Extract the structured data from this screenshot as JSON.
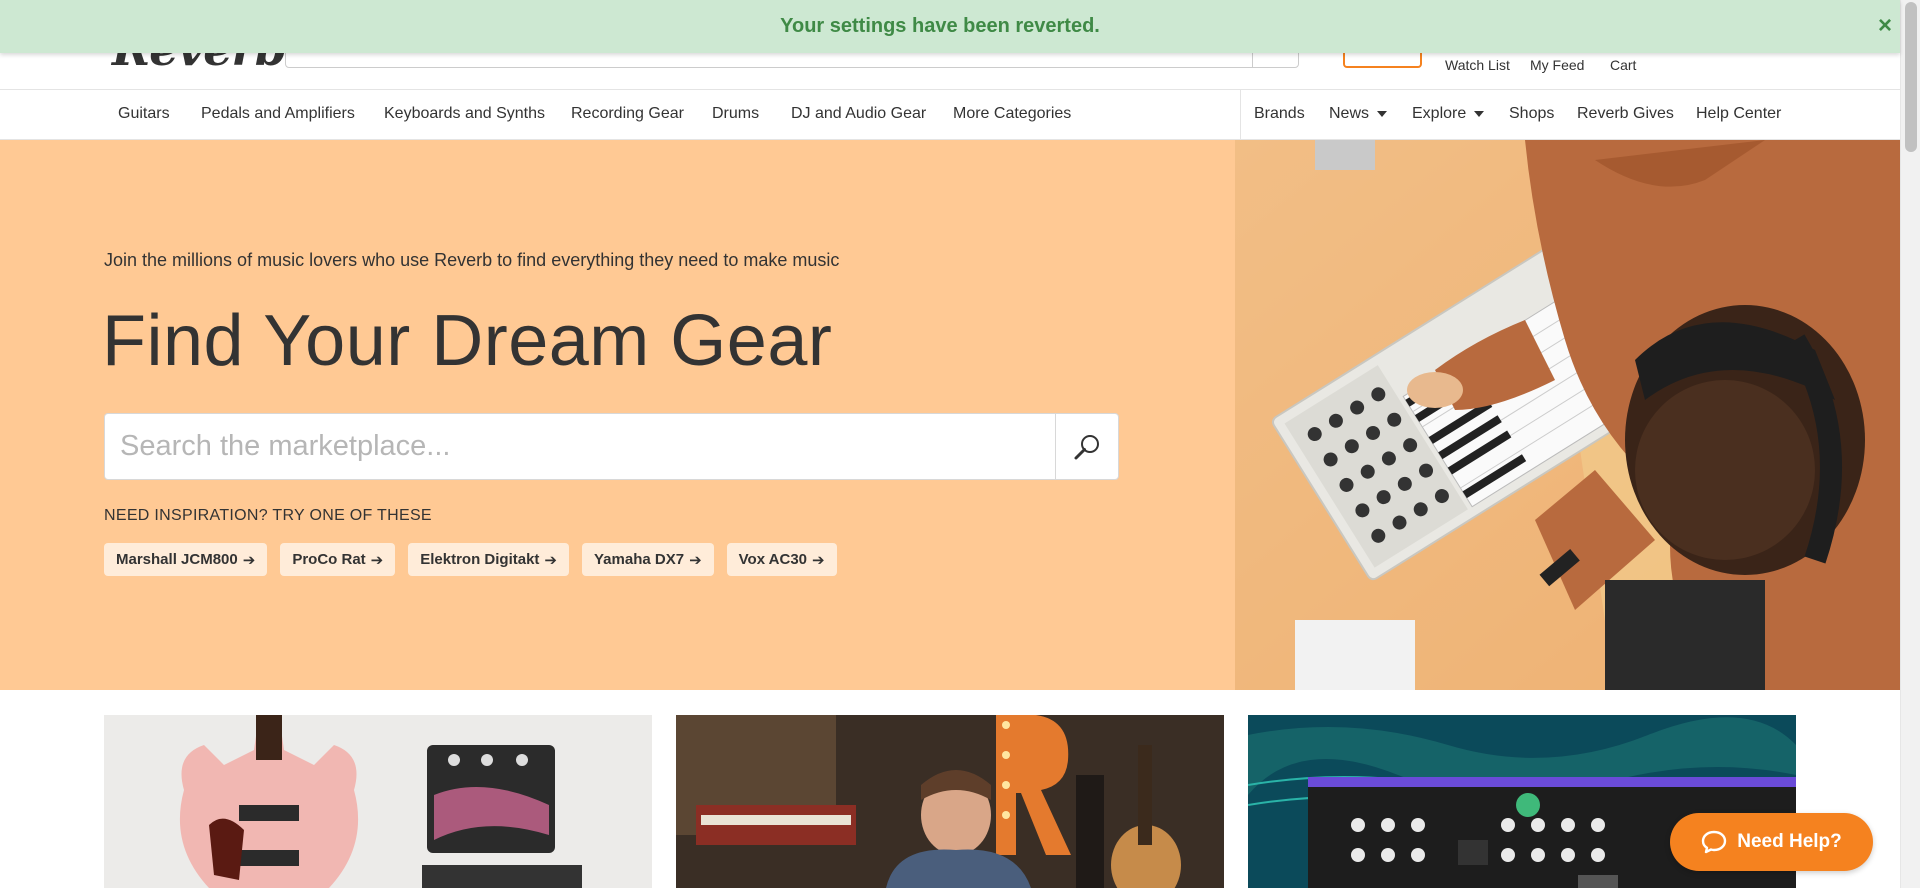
{
  "banner": {
    "message": "Your settings have been reverted.",
    "close_icon": "×"
  },
  "header": {
    "logo_text": "Reverb",
    "links": {
      "watch_list": "Watch List",
      "my_feed": "My Feed",
      "cart": "Cart"
    }
  },
  "nav": {
    "categories": [
      "Guitars",
      "Pedals and Amplifiers",
      "Keyboards and Synths",
      "Recording Gear",
      "Drums",
      "DJ and Audio Gear",
      "More Categories"
    ],
    "secondary": {
      "brands": "Brands",
      "news": "News",
      "explore": "Explore",
      "shops": "Shops",
      "reverb_gives": "Reverb Gives",
      "help_center": "Help Center"
    }
  },
  "hero": {
    "tagline": "Join the millions of music lovers who use Reverb to find everything they need to make music",
    "title": "Find Your Dream Gear",
    "search_placeholder": "Search the marketplace...",
    "inspiration_label": "NEED INSPIRATION? TRY ONE OF THESE",
    "chips": [
      "Marshall JCM800",
      "ProCo Rat",
      "Elektron Digitakt",
      "Yamaha DX7",
      "Vox AC30"
    ],
    "arrow_icon": "➔"
  },
  "need_help": {
    "label": "Need Help?"
  },
  "colors": {
    "accent": "#f5821f",
    "hero_bg": "#ffc994",
    "banner_bg": "#cde8d2",
    "banner_text": "#3f8a46"
  }
}
